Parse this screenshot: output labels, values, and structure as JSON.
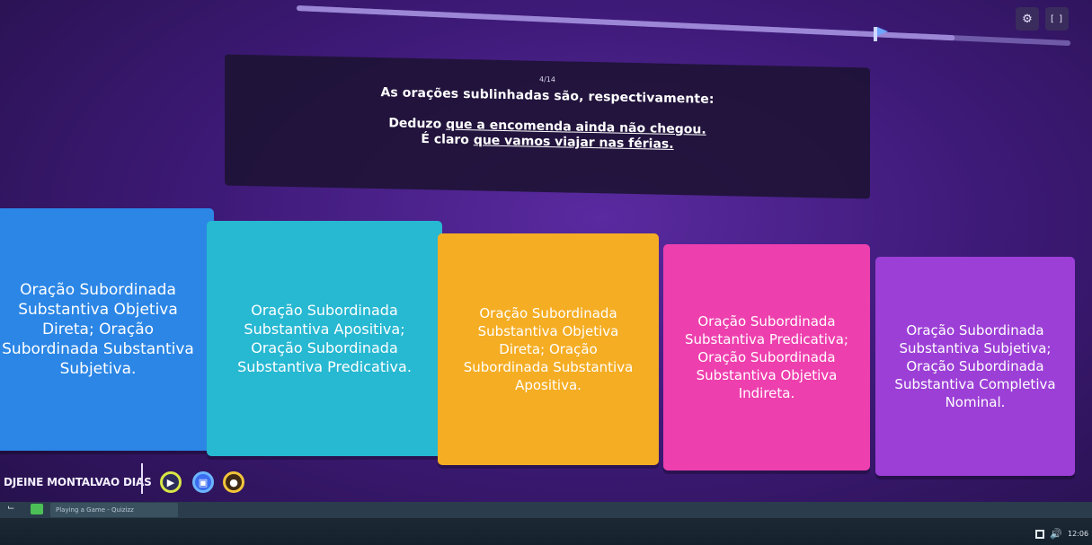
{
  "header": {
    "progress_fraction": 0.85,
    "settings_icon": "gear-icon",
    "fullscreen_label": "[ ]"
  },
  "question": {
    "counter": "4/14",
    "prompt": "As orações sublinhadas são, respectivamente:",
    "sentence_1_prefix": "Deduzo ",
    "sentence_1_underlined": "que a encomenda ainda não chegou.",
    "sentence_2_prefix": "É claro ",
    "sentence_2_underlined": "que vamos viajar nas férias."
  },
  "answers": [
    {
      "label": "Oração Subordinada\nSubstantiva Objetiva\nDireta; Oração\nSubordinada Substantiva\nSubjetiva.",
      "color": "#2b86e6"
    },
    {
      "label": "Oração Subordinada\nSubstantiva Apositiva;\nOração Subordinada\nSubstantiva Predicativa.",
      "color": "#27b8d2"
    },
    {
      "label": "Oração Subordinada\nSubstantiva Objetiva\nDireta; Oração\nSubordinada Substantiva\nApositiva.",
      "color": "#f5ad23"
    },
    {
      "label": "Oração Subordinada\nSubstantiva Predicativa;\nOração Subordinada\nSubstantiva Objetiva\nIndireta.",
      "color": "#ee3fae"
    },
    {
      "label": "Oração Subordinada\nSubstantiva Subjetiva;\nOração Subordinada\nSubstantiva Completiva\nNominal.",
      "color": "#9c3fd6"
    }
  ],
  "player": {
    "name": "DJEINE MONTALVAO DIAS"
  },
  "taskbar": {
    "window_label": "Playing a Game - Quizizz",
    "clock": "12:06"
  }
}
